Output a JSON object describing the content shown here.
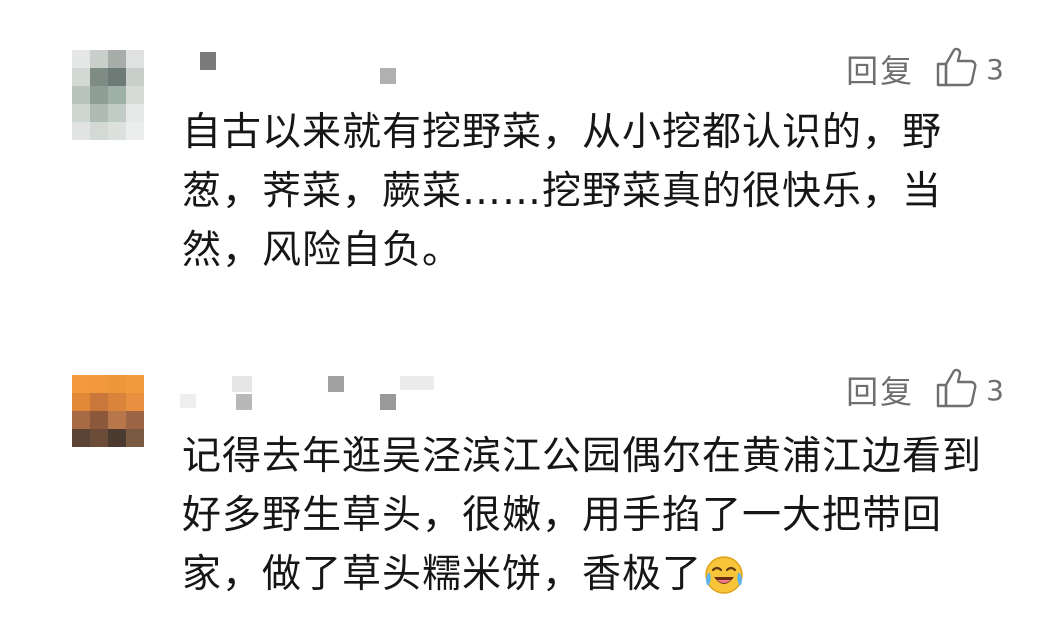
{
  "comments": [
    {
      "reply_label": "回复",
      "like_icon": "thumbs-up-outline-icon",
      "like_count": "3",
      "text": "自古以来就有挖野菜，从小挖都认识的，野葱，荠菜，蕨菜……挖野菜真的很快乐，当然，风险自负。",
      "avatar_colors": [
        "#c9d1ce",
        "#b8c3bd",
        "#7f8c86",
        "#d7dbd8",
        "#aab7b0",
        "#8f9b95",
        "#b9c4bf",
        "#e0e3e1"
      ]
    },
    {
      "reply_label": "回复",
      "like_icon": "thumbs-up-outline-icon",
      "like_count": "3",
      "text": "记得去年逛吴泾滨江公园偶尔在黄浦江边看到好多野生草头，很嫩，用手掐了一大把带回家，做了草头糯米饼，香极了",
      "emoji": "laughing-crying-emoji-icon",
      "avatar_colors": [
        "#f19a3e",
        "#d9802f",
        "#a4633a",
        "#6b4630",
        "#4d3a2e",
        "#8a5a3c"
      ]
    }
  ]
}
